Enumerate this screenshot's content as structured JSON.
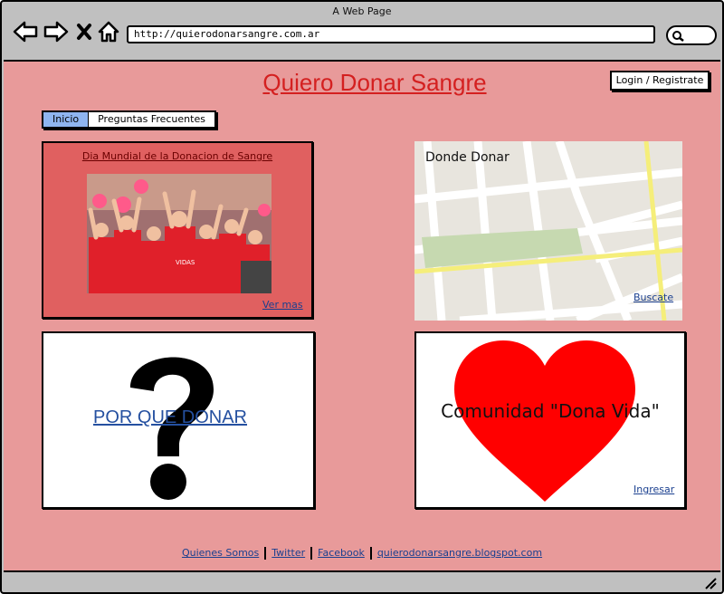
{
  "browser": {
    "window_title": "A Web Page",
    "url": "http://quierodonarsangre.com.ar"
  },
  "header": {
    "site_title": "Quiero Donar Sangre",
    "login_label": "Login / Registrate"
  },
  "tabs": [
    {
      "label": "Inicio",
      "active": true
    },
    {
      "label": "Preguntas Frecuentes",
      "active": false
    }
  ],
  "cards": {
    "news": {
      "title": "Dia Mundial de la Donacion de Sangre",
      "link": "Ver mas"
    },
    "map": {
      "title": "Donde Donar",
      "link": "Buscate"
    },
    "why": {
      "title": "POR QUE DONAR"
    },
    "community": {
      "title": "Comunidad \"Dona Vida\"",
      "link": "Ingresar"
    }
  },
  "footer": {
    "links": [
      "Quienes Somos",
      "Twitter",
      "Facebook",
      "quierodonarsangre.blogspot.com"
    ]
  },
  "colors": {
    "page_bg": "#e89a9a",
    "title_red": "#d42020",
    "link_blue": "#1a3f8f",
    "tab_active": "#8fb5f0",
    "heart_red": "#ff0000"
  }
}
